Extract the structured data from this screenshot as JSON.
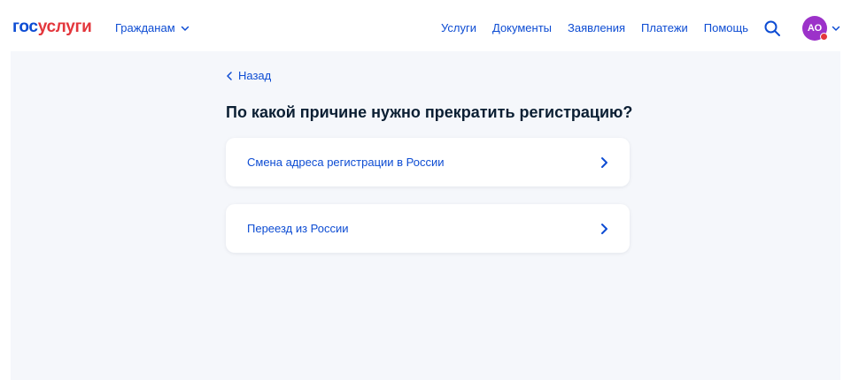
{
  "header": {
    "logo": {
      "part1": "гос",
      "part2": "услуги"
    },
    "role_switch": {
      "label": "Гражданам"
    },
    "nav": [
      "Услуги",
      "Документы",
      "Заявления",
      "Платежи",
      "Помощь"
    ],
    "avatar": {
      "initials": "АО"
    }
  },
  "main": {
    "back_label": "Назад",
    "question": "По какой причине нужно прекратить регистрацию?",
    "options": [
      {
        "label": "Смена адреса регистрации в России"
      },
      {
        "label": "Переезд из России"
      }
    ]
  },
  "colors": {
    "brand_blue": "#0d4cd3",
    "brand_red": "#e3363c",
    "avatar_purple": "#9c32c9",
    "background": "#f5f7fb"
  },
  "icons": [
    "chevron-down-icon",
    "search-icon",
    "chevron-left-icon",
    "chevron-right-icon"
  ]
}
